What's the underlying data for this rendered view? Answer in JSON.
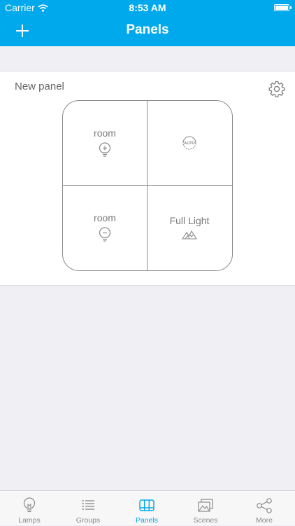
{
  "status_bar": {
    "carrier": "Carrier",
    "time": "8:53 AM"
  },
  "nav": {
    "title": "Panels"
  },
  "panel": {
    "name": "New panel",
    "cells": [
      {
        "label": "room",
        "icon": "bulb-plus-icon"
      },
      {
        "label": "",
        "icon": "auto-icon",
        "icon_text": "AUTO"
      },
      {
        "label": "room",
        "icon": "bulb-minus-icon"
      },
      {
        "label": "Full Light",
        "icon": "mountains-icon"
      }
    ]
  },
  "tabs": [
    {
      "label": "Lamps",
      "icon": "lamp-icon"
    },
    {
      "label": "Groups",
      "icon": "groups-icon"
    },
    {
      "label": "Panels",
      "icon": "panels-icon",
      "active": true
    },
    {
      "label": "Scenes",
      "icon": "scenes-icon"
    },
    {
      "label": "More",
      "icon": "share-icon"
    }
  ],
  "colors": {
    "accent": "#00a9ec",
    "background": "#efeff4"
  }
}
